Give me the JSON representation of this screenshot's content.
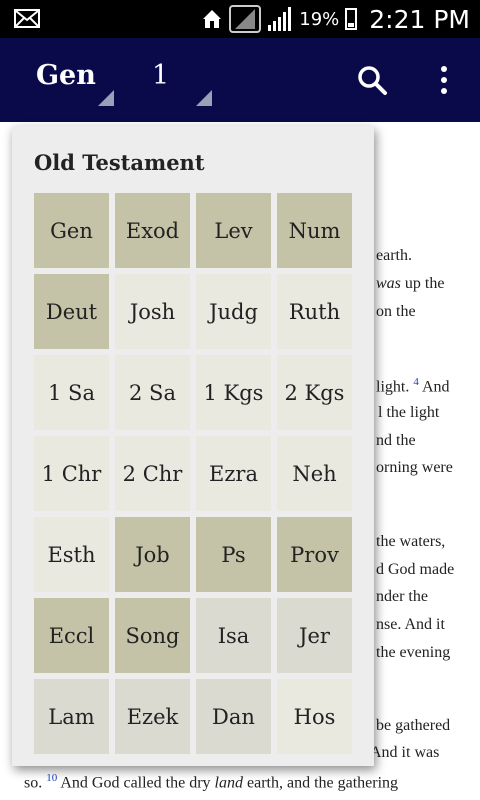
{
  "status_bar": {
    "battery": "19%",
    "time": "2:21 PM"
  },
  "app_bar": {
    "book": "Gen",
    "chapter": "1"
  },
  "bible_text": [
    {
      "parts": [
        {
          "t": "earth."
        }
      ]
    },
    {
      "parts": [
        {
          "t": "was",
          "i": true
        },
        {
          "t": " up the"
        }
      ]
    },
    {
      "parts": [
        {
          "t": "on the"
        }
      ]
    },
    {
      "parts": [
        {
          "t": "light. "
        },
        {
          "t": "4",
          "sup": true
        },
        {
          "t": " And"
        }
      ]
    },
    {
      "parts": [
        {
          "t": "l the light"
        }
      ]
    },
    {
      "parts": [
        {
          "t": "nd the"
        }
      ]
    },
    {
      "parts": [
        {
          "t": "orning were"
        }
      ]
    },
    {
      "parts": [
        {
          "t": "the waters,"
        }
      ]
    },
    {
      "parts": [
        {
          "t": "d God made"
        }
      ]
    },
    {
      "parts": [
        {
          "t": "nder the"
        }
      ]
    },
    {
      "parts": [
        {
          "t": "nse. And it"
        }
      ]
    },
    {
      "parts": [
        {
          "t": "the evening"
        }
      ]
    },
    {
      "parts": [
        {
          "t": "be gathered"
        }
      ]
    },
    {
      "parts": [
        {
          "t": "And it was"
        }
      ]
    },
    {
      "parts": [
        {
          "t": "so. "
        },
        {
          "t": "10",
          "sup": true
        },
        {
          "t": " And God called the dry "
        },
        {
          "t": "land",
          "i": true
        },
        {
          "t": " earth, and the gathering"
        }
      ]
    }
  ],
  "popup": {
    "title": "Old Testament",
    "shade_colors": {
      "dark": "#c4c3a8",
      "medium": "#dadad0",
      "light": "#e9e9e0"
    },
    "books": [
      {
        "label": "Gen",
        "shade": "dark"
      },
      {
        "label": "Exod",
        "shade": "dark"
      },
      {
        "label": "Lev",
        "shade": "dark"
      },
      {
        "label": "Num",
        "shade": "dark"
      },
      {
        "label": "Deut",
        "shade": "dark"
      },
      {
        "label": "Josh",
        "shade": "light"
      },
      {
        "label": "Judg",
        "shade": "light"
      },
      {
        "label": "Ruth",
        "shade": "light"
      },
      {
        "label": "1 Sa",
        "shade": "light"
      },
      {
        "label": "2 Sa",
        "shade": "light"
      },
      {
        "label": "1 Kgs",
        "shade": "light"
      },
      {
        "label": "2 Kgs",
        "shade": "light"
      },
      {
        "label": "1 Chr",
        "shade": "light"
      },
      {
        "label": "2 Chr",
        "shade": "light"
      },
      {
        "label": "Ezra",
        "shade": "light"
      },
      {
        "label": "Neh",
        "shade": "light"
      },
      {
        "label": "Esth",
        "shade": "light"
      },
      {
        "label": "Job",
        "shade": "dark"
      },
      {
        "label": "Ps",
        "shade": "dark"
      },
      {
        "label": "Prov",
        "shade": "dark"
      },
      {
        "label": "Eccl",
        "shade": "dark"
      },
      {
        "label": "Song",
        "shade": "dark"
      },
      {
        "label": "Isa",
        "shade": "medium"
      },
      {
        "label": "Jer",
        "shade": "medium"
      },
      {
        "label": "Lam",
        "shade": "medium"
      },
      {
        "label": "Ezek",
        "shade": "medium"
      },
      {
        "label": "Dan",
        "shade": "medium"
      },
      {
        "label": "Hos",
        "shade": "light"
      }
    ]
  }
}
